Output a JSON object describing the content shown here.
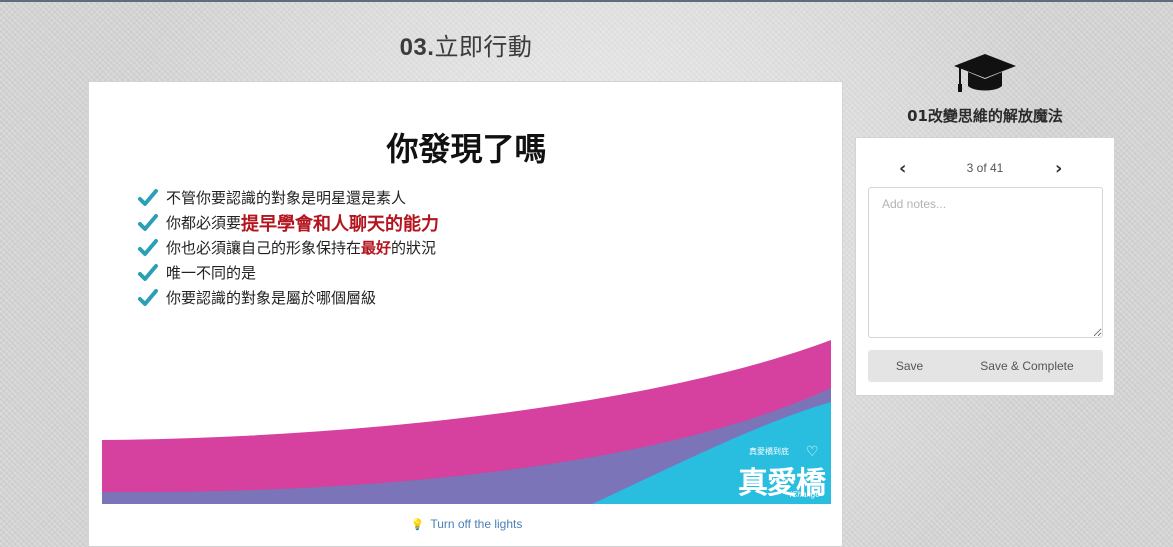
{
  "lesson": {
    "number": "03.",
    "title": "立即行動"
  },
  "slide": {
    "heading": "你發現了嗎",
    "bullets": [
      {
        "pre": "不管你要認識的對象是明星還是素人",
        "highlight": "",
        "post": ""
      },
      {
        "pre": "你都必須要",
        "highlight": "提早學會和人聊天的能力",
        "post": ""
      },
      {
        "pre": "你也必須讓自己的形象保持在",
        "highlight": "最好",
        "post": "的狀況"
      },
      {
        "pre": "唯一不同的是",
        "highlight": "",
        "post": ""
      },
      {
        "pre": "你要認識的對象是屬於哪個層級",
        "highlight": "",
        "post": ""
      }
    ],
    "logo": {
      "subtitle": "真愛橋到底",
      "main": "真愛橋",
      "english": "iChange"
    }
  },
  "lights_toggle": "Turn off the lights",
  "course": {
    "title": "01改變思維的解放魔法",
    "icon": "graduation-cap-icon"
  },
  "pager": {
    "current": 3,
    "total": 41,
    "label": "3 of 41"
  },
  "notes": {
    "placeholder": "Add notes...",
    "value": ""
  },
  "buttons": {
    "save": "Save",
    "save_complete": "Save & Complete"
  },
  "colors": {
    "check": "#2a9fb5",
    "highlight": "#b3141e",
    "magenta": "#d6409f",
    "purple": "#7b74b8",
    "cyan": "#29bde0",
    "link": "#4a7fb5"
  }
}
